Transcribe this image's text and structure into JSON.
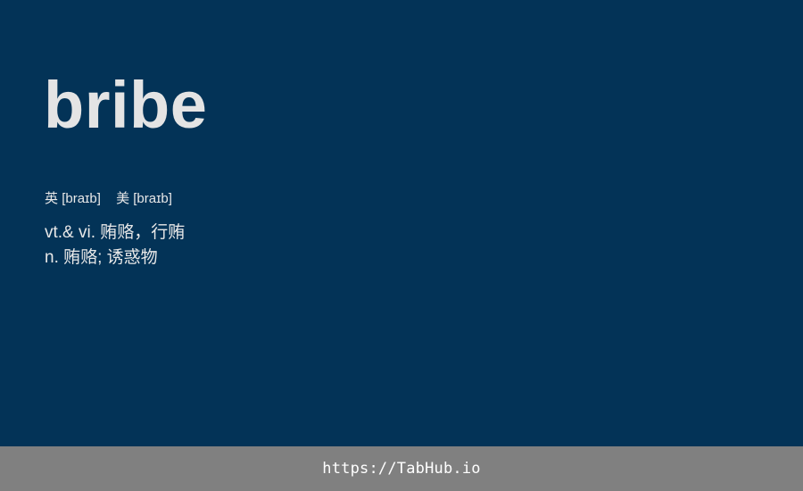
{
  "word": "bribe",
  "phonetics": {
    "uk_label": "英",
    "uk_ipa": "[braɪb]",
    "us_label": "美",
    "us_ipa": "[braɪb]"
  },
  "definitions": [
    "vt.& vi. 贿赂，行贿",
    "n. 贿赂; 诱惑物"
  ],
  "footer": {
    "link_text": "https://TabHub.io"
  },
  "colors": {
    "background": "#033357",
    "footer_background": "#808080",
    "text": "#e6e6e6"
  }
}
